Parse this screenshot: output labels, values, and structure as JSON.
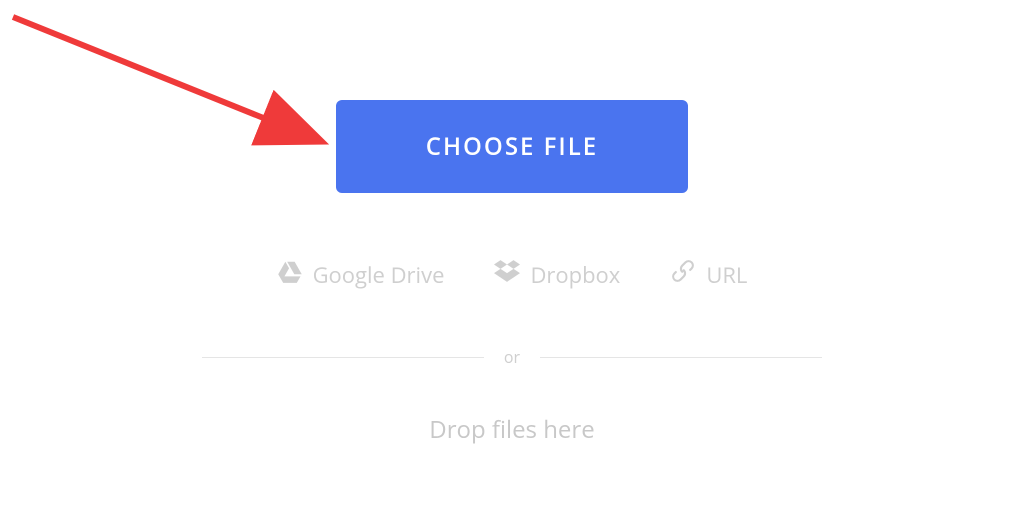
{
  "button": {
    "choose_file_label": "CHOOSE FILE"
  },
  "sources": {
    "google_drive_label": "Google Drive",
    "dropbox_label": "Dropbox",
    "url_label": "URL"
  },
  "divider": {
    "or_label": "or"
  },
  "dropzone": {
    "text": "Drop files here"
  },
  "colors": {
    "primary": "#4a74ef",
    "muted": "#cfcfcf",
    "annotation": "#ef3a3a"
  }
}
